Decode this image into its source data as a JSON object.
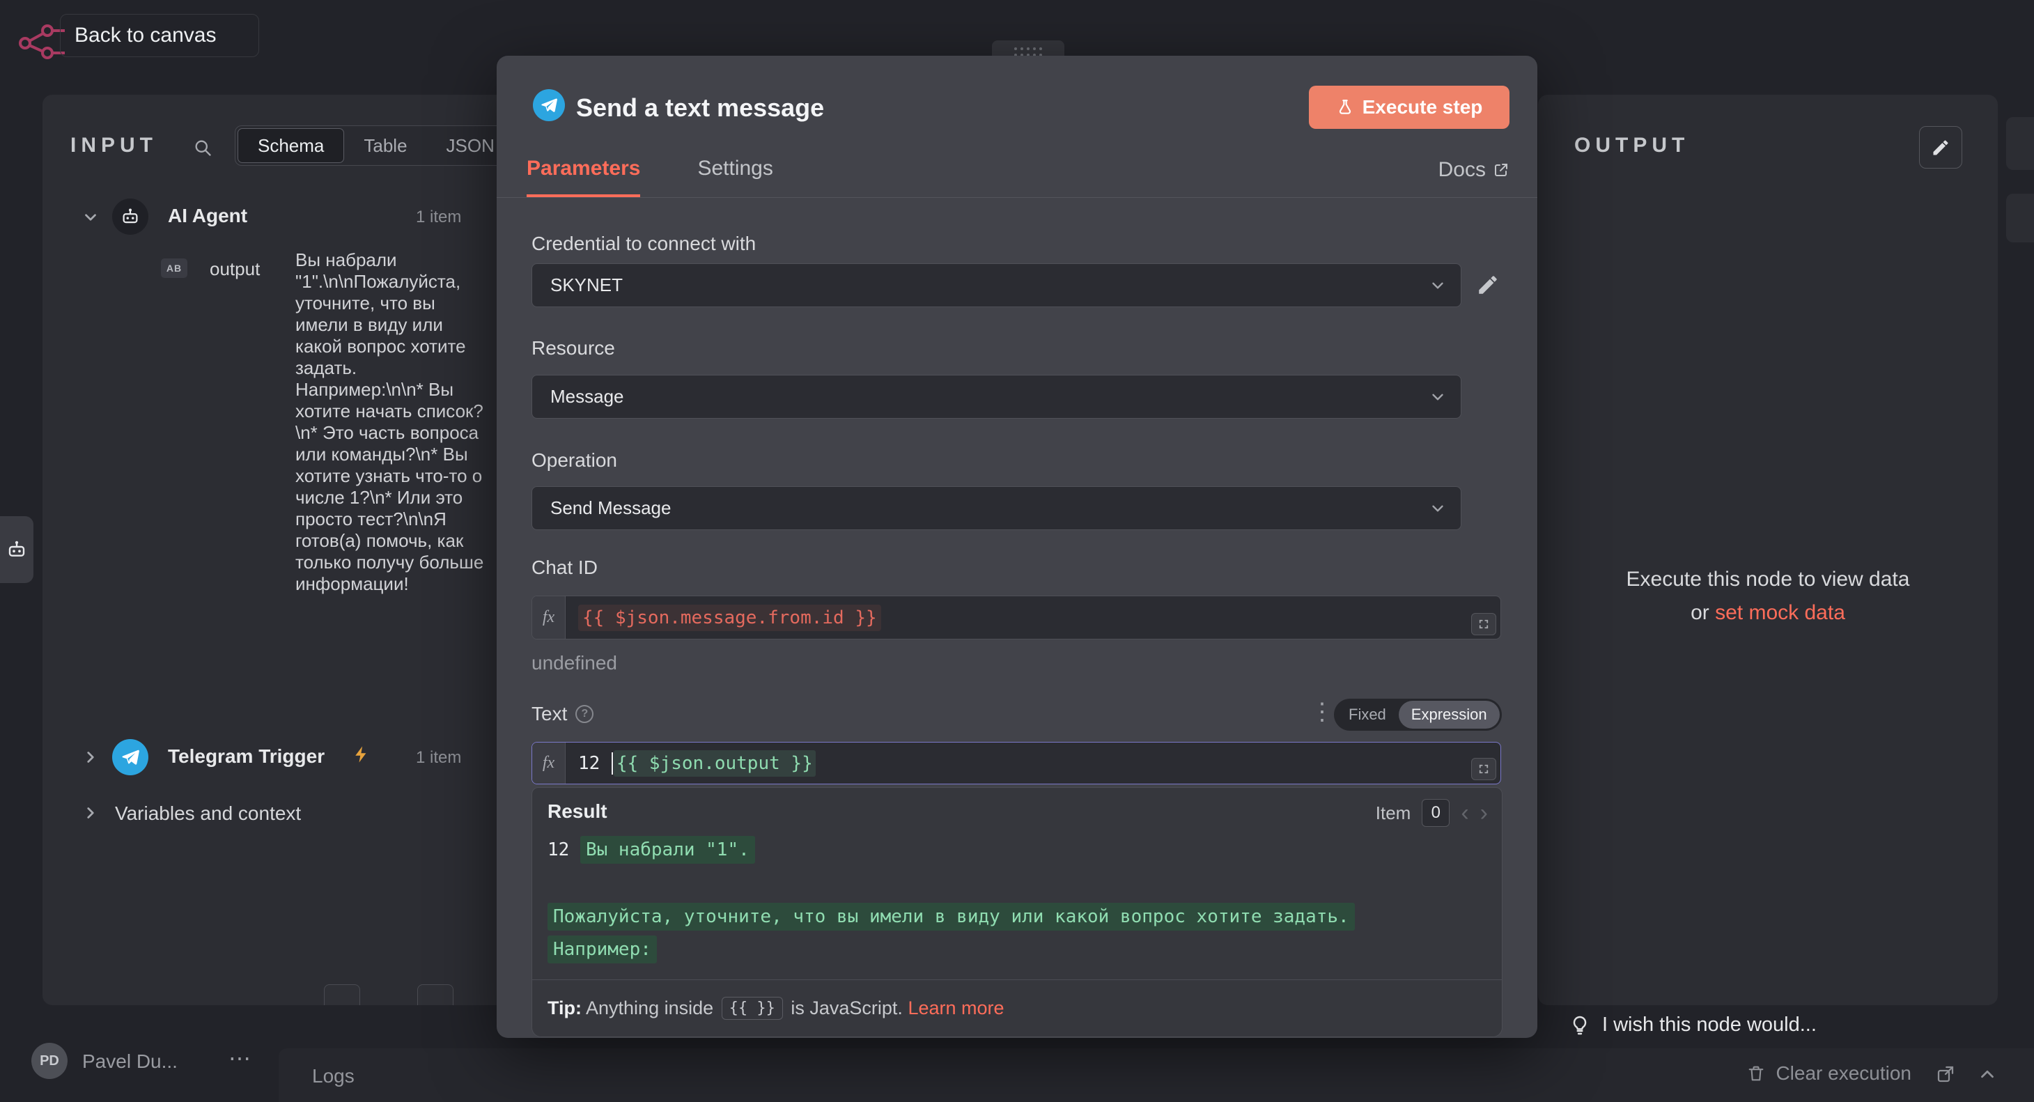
{
  "colors": {
    "accent": "#ff6d5a",
    "telegram": "#2ca5e0",
    "execute": "#ee8269",
    "green": "#8fdcb0",
    "red": "#e56a5e"
  },
  "icons": {
    "options": "⋮",
    "more": "⋯",
    "prev": "‹",
    "next": "›",
    "help": "?"
  },
  "topbar": {
    "back": "Back to canvas"
  },
  "input_panel": {
    "title": "INPUT",
    "tabs": [
      {
        "label": "Schema"
      },
      {
        "label": "Table"
      },
      {
        "label": "JSON"
      }
    ],
    "ai_agent": {
      "name": "AI Agent",
      "count": "1 item",
      "field": "output",
      "type_icon": "AB",
      "value": "Вы набрали \"1\".\\n\\nПожалуйста, уточните, что вы имели в виду или какой вопрос хотите задать. Например:\\n\\n* Вы хотите начать список?\\n* Это часть вопроса или команды?\\n* Вы хотите узнать что-то о числе 1?\\n* Или это просто тест?\\n\\nЯ готов(а) помочь, как только получу больше информации!"
    },
    "telegram_trigger": {
      "name": "Telegram Trigger",
      "count": "1 item"
    },
    "variables": {
      "name": "Variables and context"
    }
  },
  "modal": {
    "title": "Send a text message",
    "execute": "Execute step",
    "tab_parameters": "Parameters",
    "tab_settings": "Settings",
    "docs": "Docs",
    "credential": {
      "label": "Credential to connect with",
      "value": "SKYNET"
    },
    "resource": {
      "label": "Resource",
      "value": "Message"
    },
    "operation": {
      "label": "Operation",
      "value": "Send Message"
    },
    "chat_id": {
      "label": "Chat ID",
      "fx": "fx",
      "expression": "{{ $json.message.from.id }}",
      "preview": "undefined"
    },
    "text": {
      "label": "Text",
      "fixed": "Fixed",
      "expression_toggle": "Expression",
      "fx": "fx",
      "literal": "12 ",
      "expression": "{{ $json.output }}"
    },
    "result": {
      "title": "Result",
      "item_label": "Item",
      "item_index": "0",
      "line1_literal": "12 ",
      "line1_value": "Вы набрали \"1\".",
      "line2": "Пожалуйста, уточните, что вы имели в виду или какой вопрос хотите задать.",
      "line3": "Например:"
    },
    "tip": {
      "label": "Tip:",
      "text1": " Anything inside ",
      "code": "{{ }}",
      "text2": " is JavaScript. ",
      "link": "Learn more"
    }
  },
  "output_panel": {
    "title": "OUTPUT",
    "empty1": "Execute this node to view data",
    "empty2_prefix": "or ",
    "empty2_link": "set mock data",
    "wish": "I wish this node would..."
  },
  "footer": {
    "logs": "Logs",
    "clear": "Clear execution",
    "user_initials": "PD",
    "user_name": "Pavel Du..."
  }
}
